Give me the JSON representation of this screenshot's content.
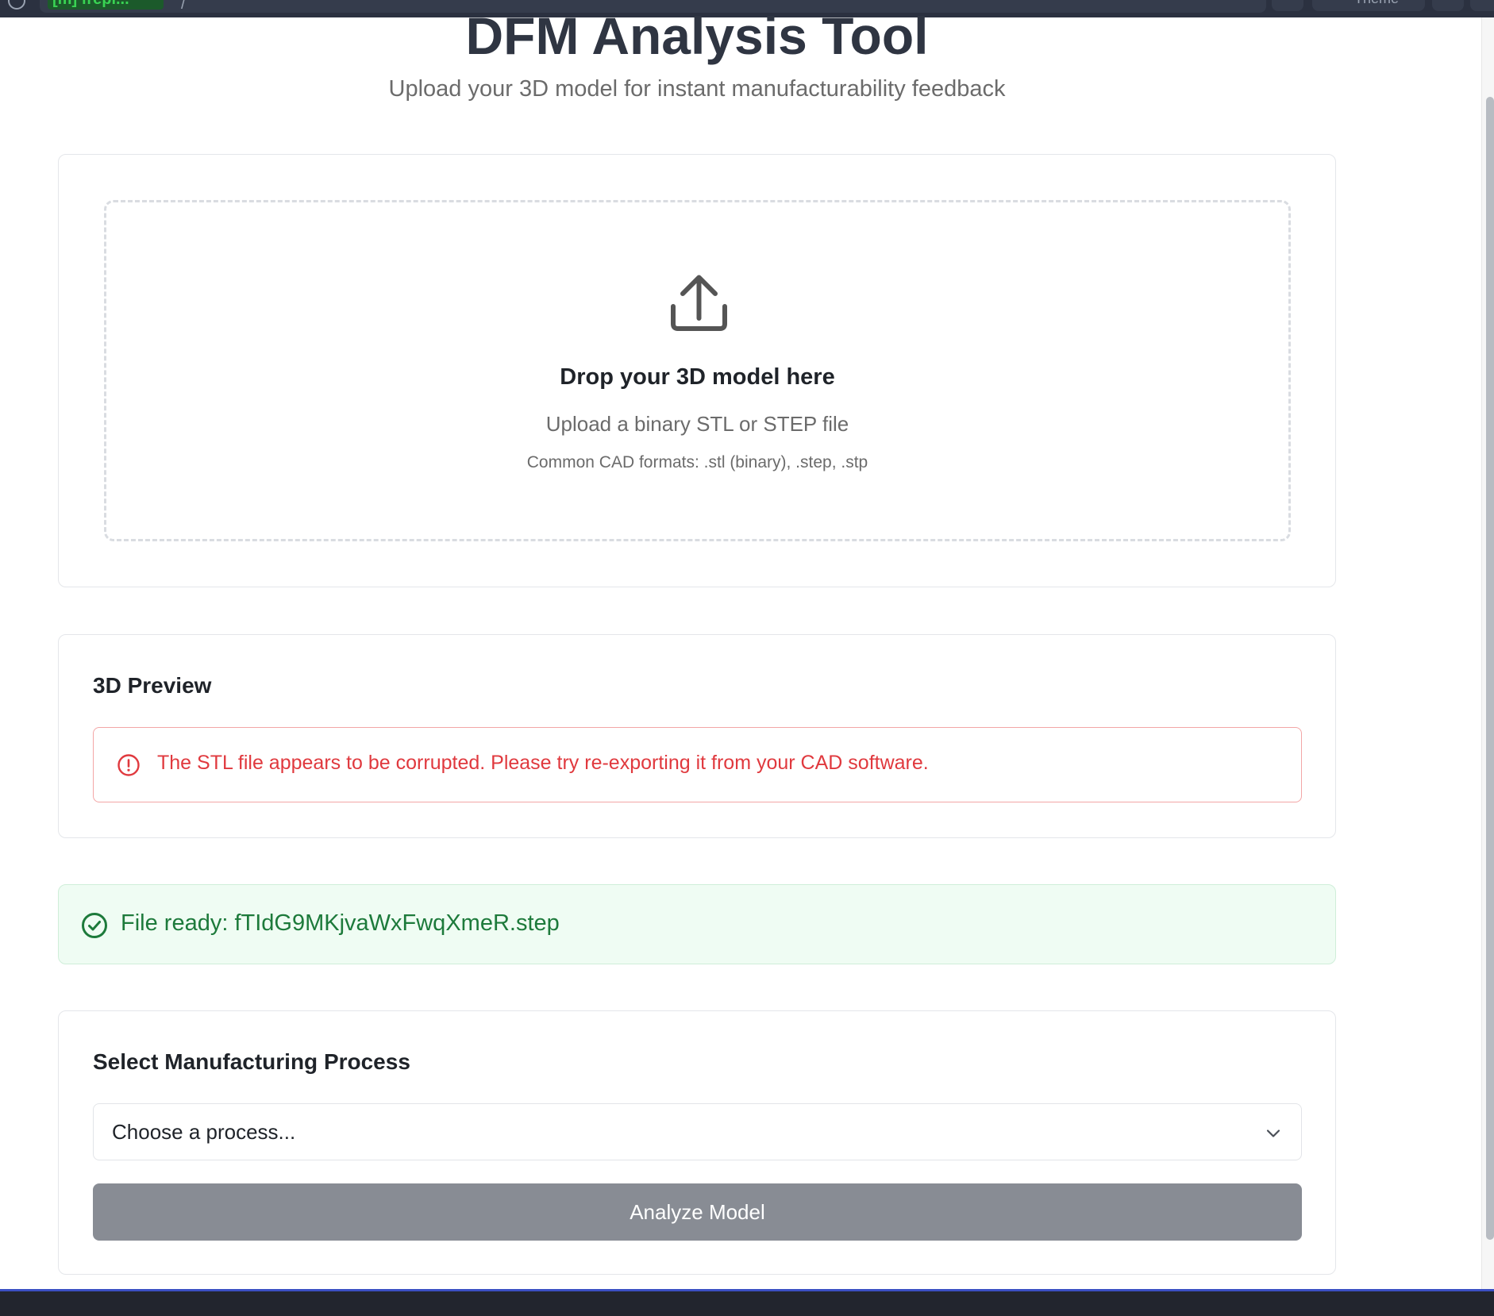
{
  "browser": {
    "tab_label": "[m] frepl...",
    "separator": "/",
    "right_label": "Theme"
  },
  "header": {
    "title": "DFM Analysis Tool",
    "subtitle": "Upload your 3D model for instant manufacturability feedback"
  },
  "upload": {
    "title": "Drop your 3D model here",
    "subtitle": "Upload a binary STL or STEP file",
    "formats": "Common CAD formats: .stl (binary), .step, .stp",
    "icon": "upload-icon"
  },
  "preview": {
    "title": "3D Preview",
    "error_message": "The STL file appears to be corrupted. Please try re-exporting it from your CAD software.",
    "error_icon": "alert-circle-icon"
  },
  "file_status": {
    "message": "File ready: fTIdG9MKjvaWxFwqXmeR.step",
    "icon": "check-circle-icon"
  },
  "process": {
    "title": "Select Manufacturing Process",
    "select_value": "Choose a process...",
    "button_label": "Analyze Model"
  },
  "colors": {
    "error": "#e0393e",
    "success": "#1d7a3b",
    "success_bg": "#effcf3",
    "button_disabled": "#888c94"
  }
}
